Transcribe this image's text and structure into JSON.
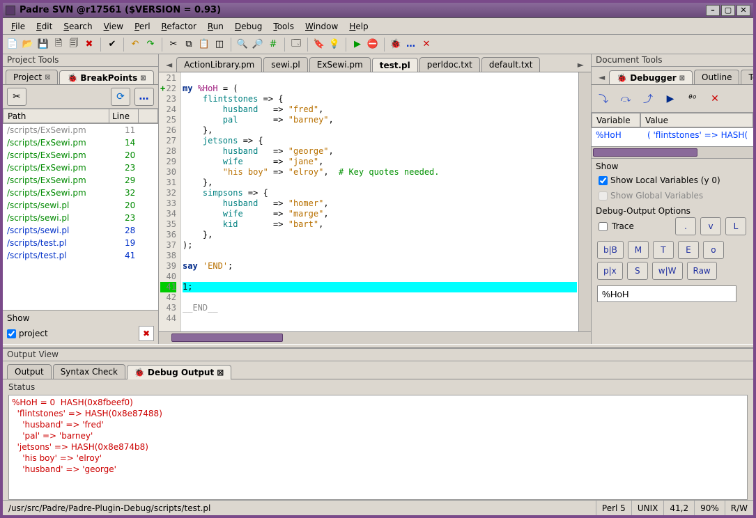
{
  "window": {
    "title": "Padre SVN @r17561 ($VERSION = 0.93)"
  },
  "menus": [
    "File",
    "Edit",
    "Search",
    "View",
    "Perl",
    "Refactor",
    "Run",
    "Debug",
    "Tools",
    "Window",
    "Help"
  ],
  "project_tools": {
    "title": "Project Tools",
    "tabs": {
      "project": "Project",
      "breakpoints": "BreakPoints"
    },
    "headers": {
      "path": "Path",
      "line": "Line"
    },
    "rows": [
      {
        "path": "/scripts/ExSewi.pm",
        "line": "11",
        "cls": "gray"
      },
      {
        "path": "/scripts/ExSewi.pm",
        "line": "14",
        "cls": "green"
      },
      {
        "path": "/scripts/ExSewi.pm",
        "line": "20",
        "cls": "green"
      },
      {
        "path": "/scripts/ExSewi.pm",
        "line": "23",
        "cls": "green"
      },
      {
        "path": "/scripts/ExSewi.pm",
        "line": "29",
        "cls": "green"
      },
      {
        "path": "/scripts/ExSewi.pm",
        "line": "32",
        "cls": "green"
      },
      {
        "path": "/scripts/sewi.pl",
        "line": "20",
        "cls": "green"
      },
      {
        "path": "/scripts/sewi.pl",
        "line": "23",
        "cls": "green"
      },
      {
        "path": "/scripts/sewi.pl",
        "line": "28",
        "cls": "blue"
      },
      {
        "path": "/scripts/test.pl",
        "line": "19",
        "cls": "blue"
      },
      {
        "path": "/scripts/test.pl",
        "line": "41",
        "cls": "blue"
      }
    ],
    "show": {
      "title": "Show",
      "project": "project"
    }
  },
  "editor": {
    "tabs": [
      "ActionLibrary.pm",
      "sewi.pl",
      "ExSewi.pm",
      "test.pl",
      "perldoc.txt",
      "default.txt"
    ],
    "active_tab": "test.pl",
    "first_line": 21,
    "last_line": 44
  },
  "document_tools": {
    "title": "Document Tools",
    "tabs": {
      "debugger": "Debugger",
      "outline": "Outline",
      "todo": "To"
    },
    "var_header": {
      "variable": "Variable",
      "value": "Value"
    },
    "var_row": {
      "name": "%HoH",
      "value": "(  'flintstones' => HASH("
    },
    "show": {
      "title": "Show",
      "local": "Show Local Variables (y 0)",
      "global": "Show Global Variables"
    },
    "debug_output": {
      "title": "Debug-Output Options",
      "trace": "Trace"
    },
    "btns_row1": [
      ".",
      "v",
      "L"
    ],
    "btns_row2": [
      "b|B",
      "M",
      "T",
      "E",
      "o"
    ],
    "btns_row3": [
      "p|x",
      "S",
      "w|W",
      "Raw"
    ],
    "input": "%HoH"
  },
  "output_view": {
    "title": "Output View",
    "tabs": {
      "output": "Output",
      "syntax": "Syntax Check",
      "debug": "Debug Output"
    },
    "status_label": "Status",
    "lines": [
      "%HoH = 0  HASH(0x8fbeef0)",
      "  'flintstones' => HASH(0x8e87488)",
      "    'husband' => 'fred'",
      "    'pal' => 'barney'",
      "  'jetsons' => HASH(0x8e874b8)",
      "    'his boy' => 'elroy'",
      "    'husband' => 'george'"
    ]
  },
  "statusbar": {
    "path": "/usr/src/Padre/Padre-Plugin-Debug/scripts/test.pl",
    "lang": "Perl 5",
    "os": "UNIX",
    "pos": "41,2",
    "zoom": "90%",
    "mode": "R/W"
  }
}
